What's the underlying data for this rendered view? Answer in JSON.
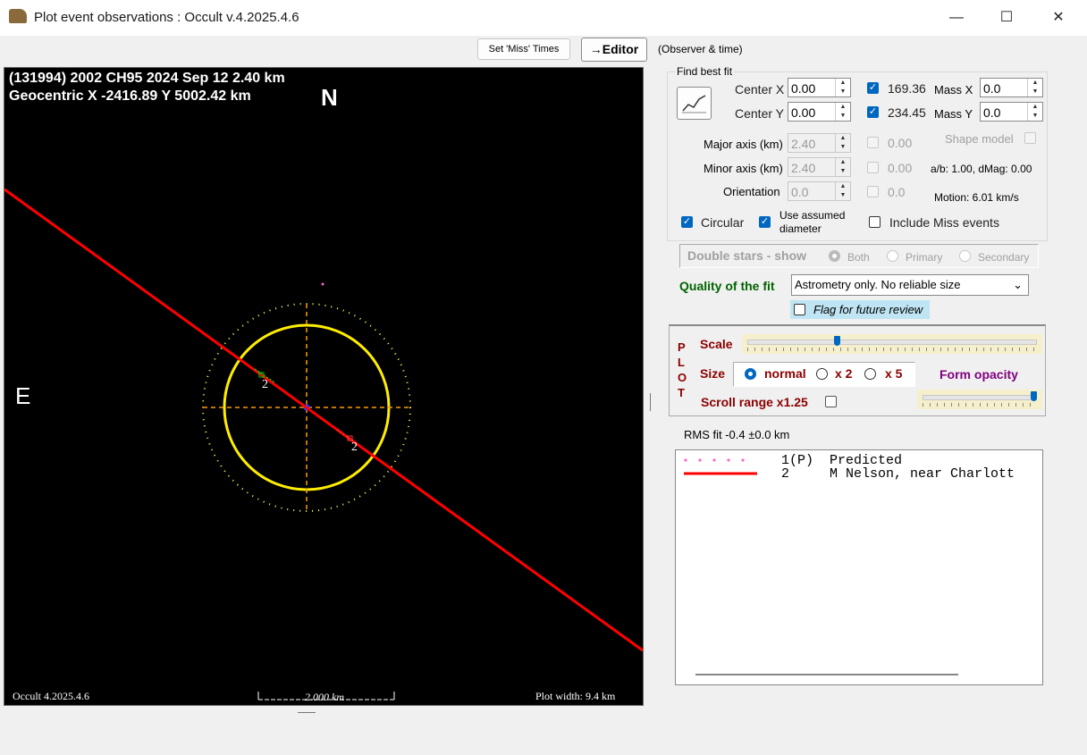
{
  "window": {
    "title": "Plot event observations : Occult v.4.2025.4.6",
    "minimize": "—",
    "maximize": "☐",
    "close": "✕"
  },
  "toolbar": {
    "set_miss_label": "Set 'Miss' Times",
    "editor_label": "→Editor",
    "observer_time_label": "(Observer & time)"
  },
  "plot": {
    "title_line1": "(131994) 2002 CH95  2024 Sep 12   2.40 km",
    "title_line2": "Geocentric  X  -2416.89  Y 5002.42 km",
    "north_label": "N",
    "east_label": "E",
    "version_label": "Occult 4.2025.4.6",
    "scale_label": "2.000 km",
    "plot_width_label": "Plot width: 9.4 km",
    "chord_label_a": "2",
    "chord_label_b": "2"
  },
  "fit": {
    "group_label": "Find best fit",
    "center_x_label": "Center X",
    "center_x_value": "0.00",
    "center_y_label": "Center Y",
    "center_y_value": "0.00",
    "check_x_value": "169.36",
    "check_y_value": "234.45",
    "mass_x_label": "Mass X",
    "mass_x_value": "0.0",
    "mass_y_label": "Mass Y",
    "mass_y_value": "0.0",
    "major_axis_label": "Major axis (km)",
    "major_axis_value": "2.40",
    "major_axis_chk": "0.00",
    "minor_axis_label": "Minor axis (km)",
    "minor_axis_value": "2.40",
    "minor_axis_chk": "0.00",
    "orientation_label": "Orientation",
    "orientation_value": "0.0",
    "orientation_chk": "0.0",
    "shape_model_label": "Shape model",
    "ab_dmag_label": "a/b: 1.00, dMag: 0.00",
    "motion_label": "Motion: 6.01 km/s",
    "circular_label": "Circular",
    "use_assumed_label_1": "Use assumed",
    "use_assumed_label_2": "diameter",
    "include_miss_label": "Include Miss events"
  },
  "double_stars": {
    "label": "Double stars - show",
    "both": "Both",
    "primary": "Primary",
    "secondary": "Secondary"
  },
  "quality": {
    "label": "Quality of the fit",
    "selected": "Astrometry only. No reliable size",
    "flag_label": "Flag for future review"
  },
  "plot_opts": {
    "plot_vertical": [
      "P",
      "L",
      "O",
      "T"
    ],
    "scale_label": "Scale",
    "scale_level": 0.31,
    "size_label": "Size",
    "normal_label": "normal",
    "x2_label": "x 2",
    "x5_label": "x 5",
    "form_opacity_label": "Form opacity",
    "opacity_level": 0.97,
    "scroll_range_label": "Scroll range x1.25"
  },
  "rms": {
    "label": "RMS fit -0.4 ±0.0 km"
  },
  "legend": {
    "row1": "1(P)  Predicted",
    "row2": "2     M Nelson, near Charlott"
  },
  "colors": {
    "chord": "#ff0000",
    "fit_circle": "#ffff00",
    "predicted": "#ff66cc",
    "axis": "#ff9900",
    "center": "#2040ff"
  }
}
